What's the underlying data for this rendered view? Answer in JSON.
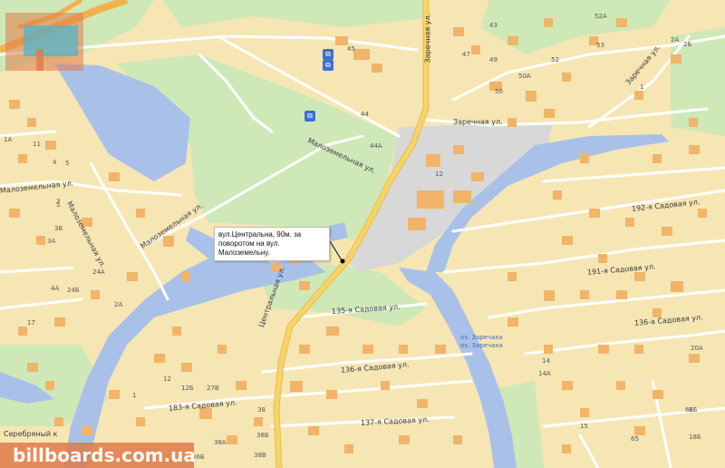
{
  "callout": {
    "lines": [
      "вул.Центральна, 90м. за",
      "поворотом на вул. Малоземельну."
    ]
  },
  "watermark": "billboards.com.ua",
  "streets": {
    "zarechnaya_vertical": "Заречная ул.",
    "zarechnaya": "Заречная ул.",
    "zarechnaya_ne": "Заречная ул.",
    "malozemelnaya_main": "Малоземельная ул.",
    "malozemelnaya_left": "Малоземельная ул.",
    "malozemelnaya_mid": "Малоземельная ул.",
    "malozemelnaya_diag": "Малоземельная ул.",
    "tsentralnaya": "Центральная ул.",
    "sad135": "135-я Садовая ул.",
    "sad136": "136-я Садовая ул.",
    "sad136a": "136-а Садовая ул.",
    "sad137": "137-я Садовая ул.",
    "sad183": "183-я Садовая ул.",
    "sad191": "191-я Садовая ул.",
    "sad192": "192-я Садовая ул.",
    "serebryany": "Серебряный к"
  },
  "water_labels": [
    "оз. Заречаха",
    "оз. Заречаха"
  ],
  "house_numbers": [
    "45",
    "47",
    "49",
    "43",
    "44",
    "44А",
    "12",
    "50",
    "50А",
    "53",
    "52",
    "52А",
    "2А",
    "2Б",
    "1",
    "4",
    "5",
    "5",
    "3",
    "3А",
    "3Б",
    "1А",
    "11",
    "24А",
    "24Б",
    "2А",
    "4А",
    "17",
    "12",
    "12Б",
    "27В",
    "38",
    "38Б",
    "38В",
    "38А",
    "36Б",
    "6Б",
    "14",
    "14А",
    "15",
    "20А",
    "18Б",
    "65",
    "61",
    "1"
  ],
  "colors": {
    "land": "#f6e6b4",
    "water": "#a9c1e9",
    "park": "#cfe8b8",
    "industrial": "#d8d8d8",
    "building": "#f1b469",
    "main_road": "#f7d36b",
    "road": "#ffffff",
    "watermark_bg": "#e07a4b"
  },
  "icons": [
    "bus-stop-icon",
    "bus-stop-icon",
    "location-marker-icon",
    "billboards-logo-icon"
  ]
}
